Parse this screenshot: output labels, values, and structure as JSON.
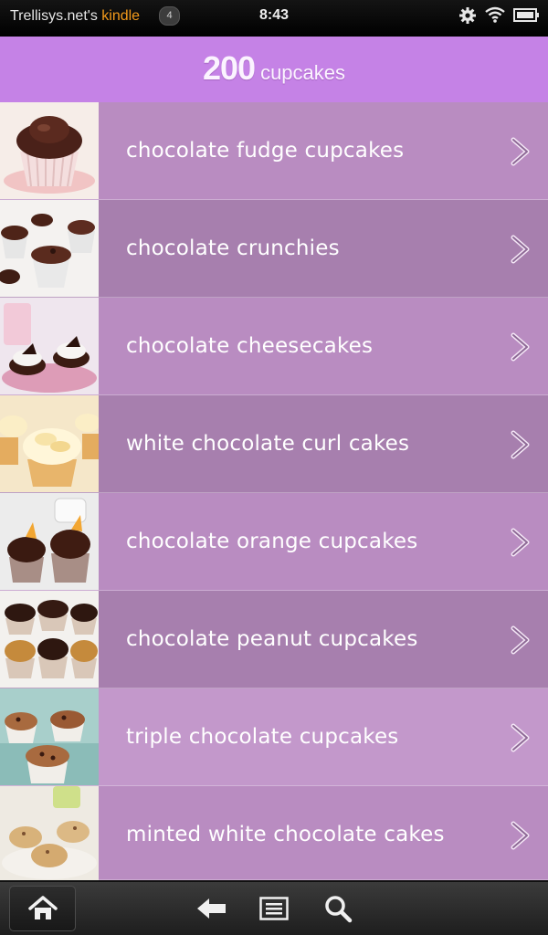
{
  "status_bar": {
    "owner_name": "Trellisys.net's ",
    "device_word": "kindle",
    "notification_count": "4",
    "time": "8:43",
    "icons": [
      "gear-icon",
      "wifi-icon",
      "battery-icon"
    ]
  },
  "header": {
    "count": "200",
    "title": "cupcakes"
  },
  "recipes": [
    {
      "label": "chocolate fudge cupcakes",
      "thumb": "chocolate-fudge-cupcake-photo"
    },
    {
      "label": "chocolate crunchies",
      "thumb": "chocolate-crunchies-photo"
    },
    {
      "label": "chocolate cheesecakes",
      "thumb": "chocolate-cheesecakes-photo"
    },
    {
      "label": "white chocolate curl cakes",
      "thumb": "white-chocolate-curl-cakes-photo"
    },
    {
      "label": "chocolate orange cupcakes",
      "thumb": "chocolate-orange-cupcakes-photo"
    },
    {
      "label": "chocolate peanut cupcakes",
      "thumb": "chocolate-peanut-cupcakes-photo"
    },
    {
      "label": "triple chocolate cupcakes",
      "thumb": "triple-chocolate-cupcakes-photo"
    },
    {
      "label": "minted white chocolate cakes",
      "thumb": "minted-white-chocolate-cakes-photo"
    }
  ],
  "nav": {
    "buttons": [
      "home-icon",
      "back-icon",
      "menu-icon",
      "search-icon"
    ]
  },
  "colors": {
    "title_bar": "#c582e6",
    "orange_accent": "#f39a1b"
  }
}
